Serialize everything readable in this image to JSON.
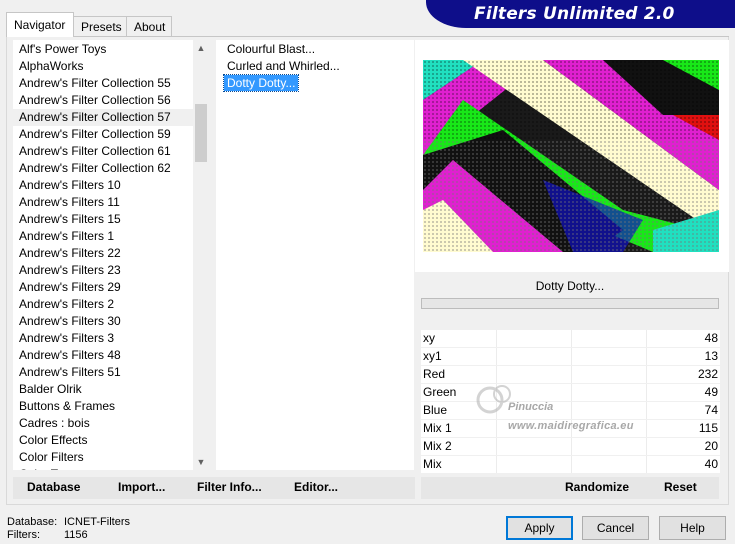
{
  "banner": {
    "title": "Filters Unlimited 2.0"
  },
  "tabs": [
    {
      "label": "Navigator",
      "active": true
    },
    {
      "label": "Presets",
      "active": false
    },
    {
      "label": "About",
      "active": false
    }
  ],
  "categories": [
    "Alf's Power Toys",
    "AlphaWorks",
    "Andrew's Filter Collection 55",
    "Andrew's Filter Collection 56",
    "Andrew's Filter Collection 57",
    "Andrew's Filter Collection 59",
    "Andrew's Filter Collection 61",
    "Andrew's Filter Collection 62",
    "Andrew's Filters 10",
    "Andrew's Filters 11",
    "Andrew's Filters 15",
    "Andrew's Filters 1",
    "Andrew's Filters 22",
    "Andrew's Filters 23",
    "Andrew's Filters 29",
    "Andrew's Filters 2",
    "Andrew's Filters 30",
    "Andrew's Filters 3",
    "Andrew's Filters 48",
    "Andrew's Filters 51",
    "Balder Olrik",
    "Buttons & Frames",
    "Cadres : bois",
    "Color Effects",
    "Color Filters",
    "Color Ton..."
  ],
  "selected_category": "Andrew's Filter Collection 57",
  "filters": [
    "Colourful Blast...",
    "Curled and Whirled...",
    "Dotty Dotty..."
  ],
  "selected_filter": "Dotty Dotty...",
  "preview": {
    "filter_name": "Dotty Dotty..."
  },
  "params": [
    {
      "name": "xy",
      "value": "48"
    },
    {
      "name": "xy1",
      "value": "13"
    },
    {
      "name": "Red",
      "value": "232"
    },
    {
      "name": "Green",
      "value": "49"
    },
    {
      "name": "Blue",
      "value": "74"
    },
    {
      "name": "Mix 1",
      "value": "115"
    },
    {
      "name": "Mix 2",
      "value": "20"
    },
    {
      "name": "Mix",
      "value": "40"
    }
  ],
  "watermark": {
    "name": "Pinuccia",
    "url": "www.maidiregrafica.eu"
  },
  "toolbar": {
    "database": "Database",
    "import": "Import...",
    "filter_info": "Filter Info...",
    "editor": "Editor...",
    "randomize": "Randomize",
    "reset": "Reset"
  },
  "footer": {
    "database_label": "Database:",
    "database_value": "ICNET-Filters",
    "filters_label": "Filters:",
    "filters_value": "1156",
    "apply": "Apply",
    "cancel": "Cancel",
    "help": "Help"
  },
  "colors": {
    "accent": "#0078d7",
    "selection": "#3399ff",
    "banner": "#0e0e8a"
  },
  "icons": {
    "scroll_up": "chevron-up-icon",
    "scroll_down": "chevron-down-icon"
  }
}
